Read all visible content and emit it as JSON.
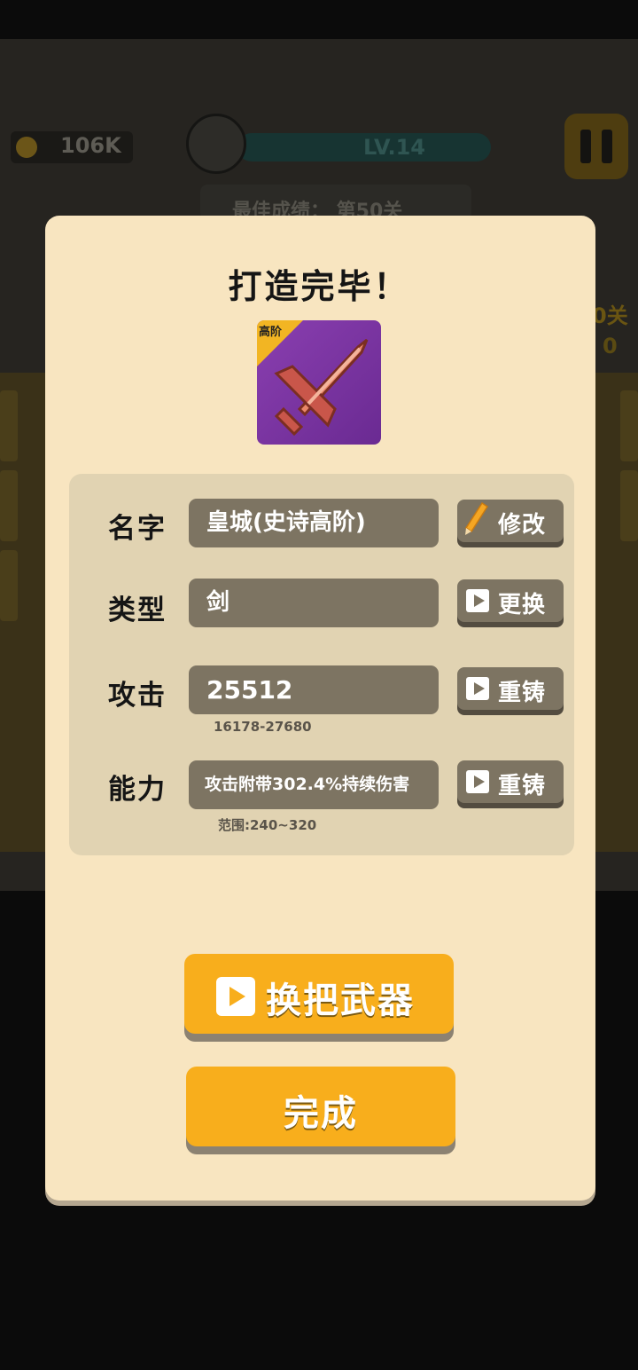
{
  "background": {
    "coins": "106K",
    "level": "LV.14",
    "best_score": "最佳成绩： 第50关",
    "side_stage": "0关",
    "side_number": "0"
  },
  "modal": {
    "title": "打造完毕！",
    "item": {
      "tier_tag": "高阶",
      "icon": "sword-icon"
    },
    "rows": [
      {
        "label": "名字",
        "value": "皇城(史诗高阶)",
        "button": "修改",
        "button_icon": "pencil-icon"
      },
      {
        "label": "类型",
        "value": "剑",
        "button": "更换",
        "button_icon": "video-play-icon"
      },
      {
        "label": "攻击",
        "value": "25512",
        "range": "16178-27680",
        "button": "重铸",
        "button_icon": "video-play-icon"
      },
      {
        "label": "能力",
        "value": "攻击附带302.4%持续伤害",
        "range": "范围:240~320",
        "button": "重铸",
        "button_icon": "video-play-icon"
      }
    ],
    "change_weapon_button": "换把武器",
    "done_button": "完成"
  },
  "colors": {
    "panel_bg": "#f8e5c0",
    "field_bg": "#7d7462",
    "accent_orange": "#f8ae1c",
    "item_purple": "#7b35a3"
  }
}
